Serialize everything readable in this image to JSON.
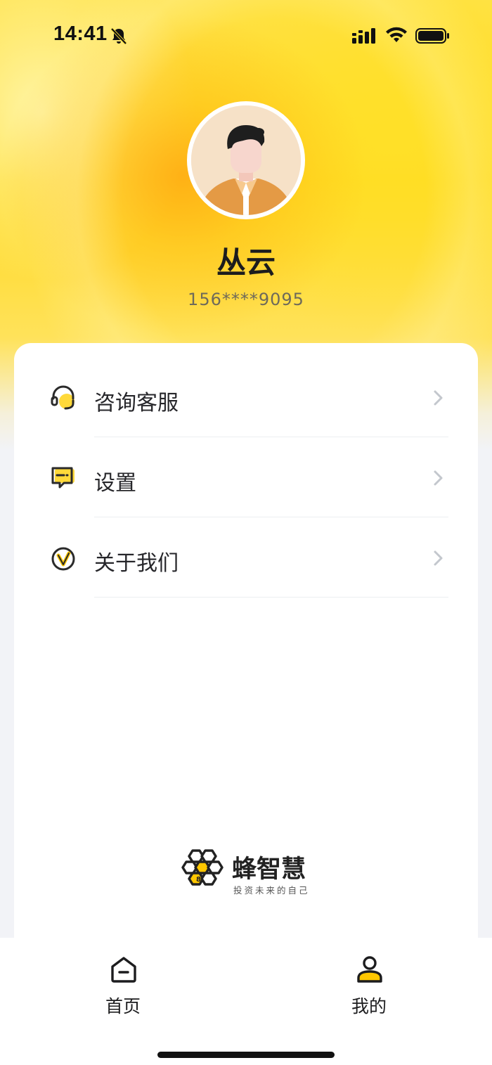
{
  "status_bar": {
    "time": "14:41"
  },
  "profile": {
    "name": "丛云",
    "phone": "156****9095"
  },
  "menu": {
    "items": [
      {
        "label": "咨询客服",
        "icon": "headset-icon"
      },
      {
        "label": "设置",
        "icon": "message-square-icon"
      },
      {
        "label": "关于我们",
        "icon": "v-circle-icon"
      }
    ]
  },
  "brand": {
    "name": "蜂智慧",
    "slogan": "投资未来的自己"
  },
  "tabbar": {
    "tabs": [
      {
        "label": "首页",
        "icon": "home-icon"
      },
      {
        "label": "我的",
        "icon": "user-icon",
        "active": true
      }
    ]
  },
  "colors": {
    "accent": "#FFD21E",
    "icon_yellow": "#FFC700",
    "text_primary": "#1C1C1E",
    "text_secondary": "#6E6A5A"
  }
}
